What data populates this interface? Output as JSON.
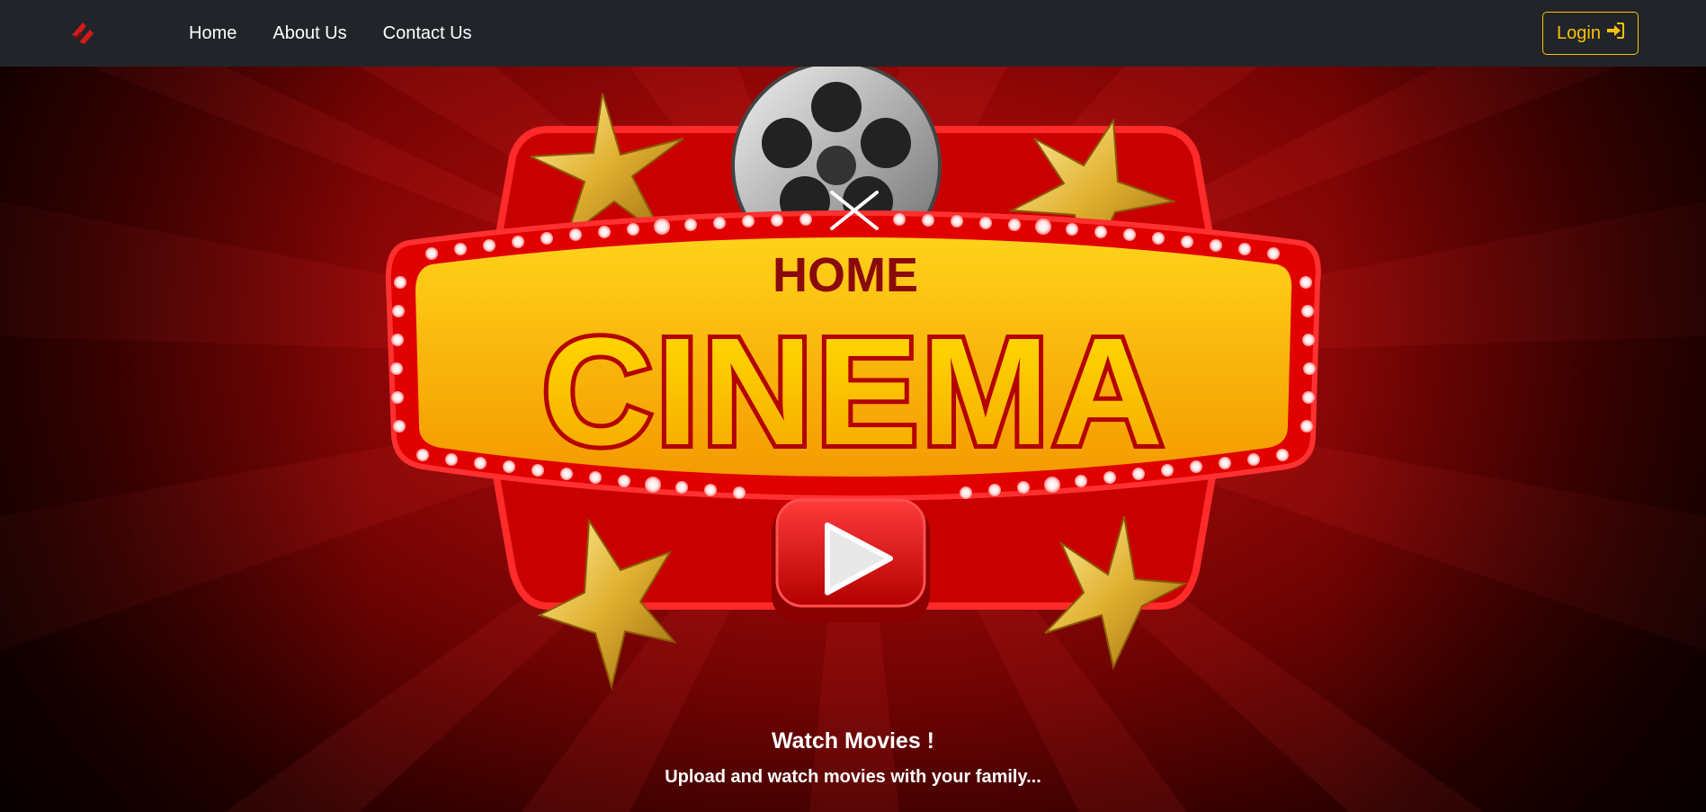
{
  "navbar": {
    "brand_icon": "film-logo-icon",
    "links": [
      "Home",
      "About Us",
      "Contact Us"
    ],
    "login_label": "Login",
    "login_icon": "sign-in-icon"
  },
  "hero": {
    "sign_top_word": "HOME",
    "sign_main_word": "CINEMA",
    "caption_title": "Watch Movies !",
    "caption_text": "Upload and watch movies with your family...",
    "prev_icon": "chevron-left-icon",
    "next_icon": "chevron-right-icon"
  },
  "colors": {
    "navbar_bg": "#212529",
    "accent": "#ffc107",
    "hero_red": "#c40d0d"
  }
}
